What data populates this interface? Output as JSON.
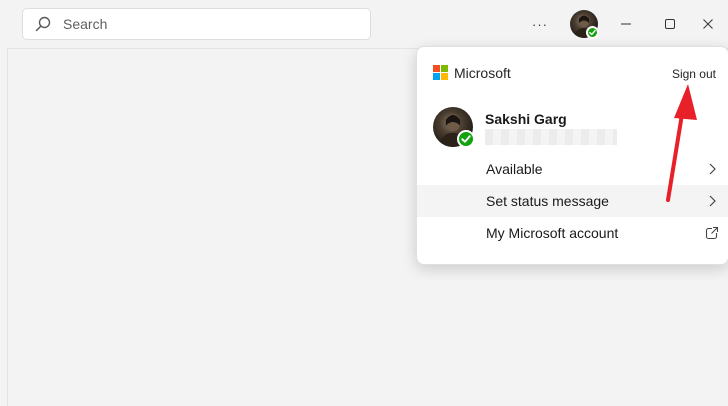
{
  "search": {
    "placeholder": "Search"
  },
  "titlebar": {
    "more_label": "···"
  },
  "flyout": {
    "brand": "Microsoft",
    "sign_out": "Sign out",
    "user_name": "Sakshi Garg",
    "items": [
      {
        "label": "Available",
        "icon": "chevron-right-icon"
      },
      {
        "label": "Set status message",
        "icon": "chevron-right-icon"
      },
      {
        "label": "My Microsoft account",
        "icon": "external-link-icon"
      }
    ]
  },
  "colors": {
    "status_green": "#13a10e",
    "annotation_red": "#e8202a",
    "ms_red": "#f25022",
    "ms_green": "#7fba00",
    "ms_blue": "#00a4ef",
    "ms_yellow": "#ffb900"
  }
}
